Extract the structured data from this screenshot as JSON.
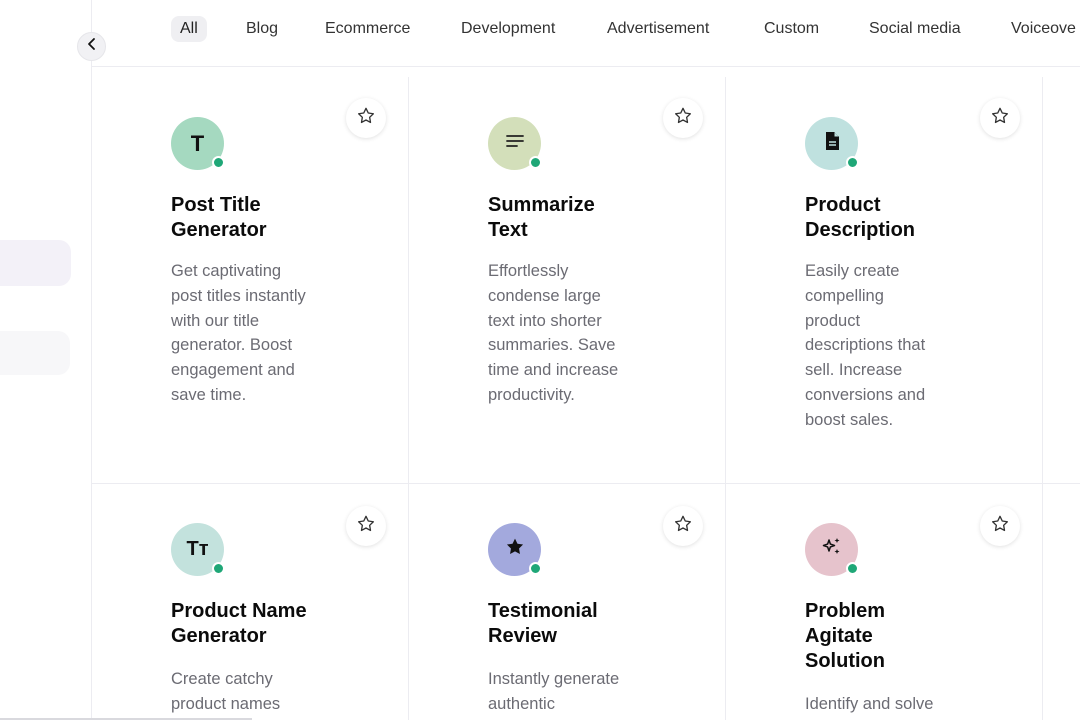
{
  "sidebar": {
    "collapse_icon": "chevron-left-icon"
  },
  "tabs": [
    {
      "label": "All",
      "active": true
    },
    {
      "label": "Blog"
    },
    {
      "label": "Ecommerce"
    },
    {
      "label": "Development"
    },
    {
      "label": "Advertisement"
    },
    {
      "label": "Custom"
    },
    {
      "label": "Social media"
    },
    {
      "label": "Voiceove"
    }
  ],
  "cards": [
    {
      "title_line1": "Post Title",
      "title_line2": "Generator",
      "avatar_text": "T",
      "avatar_color": "#a5d9c0",
      "icon": "letter-t-icon",
      "desc": [
        "Get captivating",
        "post titles instantly",
        "with our title",
        "generator. Boost",
        "engagement and",
        "save time."
      ]
    },
    {
      "title_line1": "Summarize",
      "title_line2": "Text",
      "avatar_color": "#d3dfba",
      "icon": "text-lines-icon",
      "desc": [
        "Effortlessly",
        "condense large",
        "text into shorter",
        "summaries. Save",
        "time and increase",
        "productivity."
      ]
    },
    {
      "title_line1": "Product",
      "title_line2": "Description",
      "avatar_color": "#bfe1df",
      "icon": "document-icon",
      "desc": [
        "Easily create",
        "compelling",
        "product",
        "descriptions that",
        "sell. Increase",
        "conversions and",
        "boost sales."
      ]
    },
    {
      "title_line1": "Product Name",
      "title_line2": "Generator",
      "avatar_text": "Tт",
      "avatar_color": "#c3e2dd",
      "icon": "text-size-icon",
      "desc": [
        "Create catchy",
        "product names"
      ]
    },
    {
      "title_line1": "Testimonial",
      "title_line2": "Review",
      "avatar_color": "#a3a9dd",
      "icon": "star-solid-icon",
      "desc": [
        "Instantly generate",
        "authentic"
      ]
    },
    {
      "title_line1": "Problem",
      "title_line2": "Agitate",
      "title_line3": "Solution",
      "avatar_color": "#e6c3cc",
      "icon": "sparkles-icon",
      "desc": [
        "Identify and solve"
      ]
    }
  ],
  "colors": {
    "online": "#1fa777",
    "accent_pill": "#f3f1f8"
  }
}
